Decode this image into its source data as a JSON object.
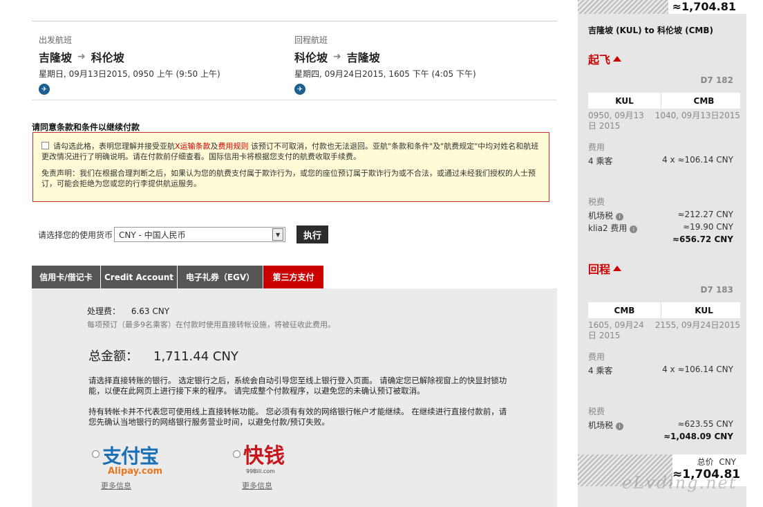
{
  "outbound": {
    "label": "出发航班",
    "from": "吉隆坡",
    "to": "科伦坡",
    "date": "星期日, 09月13日2015, 0950 上午 (9:50 上午)"
  },
  "return": {
    "label": "回程航班",
    "from": "科伦坡",
    "to": "吉隆坡",
    "date": "星期四, 09月24日2015, 1605 下午 (4:05 下午)"
  },
  "terms": {
    "title": "请同意条款和条件以继续付款",
    "agree_pre": "请勾选此格，表明您理解并接受亚航",
    "link1": "X运输条款",
    "and": "及",
    "link2": "费用规则",
    "agree_post": " 该预订不可取消，付款也无法退回。亚航\"条款和条件\"及\"航费规定\"中均对姓名和航班更改情况进行了明确说明。请在付款前仔细查看。国际信用卡将根据您支付的航费收取手续费。",
    "disclaimer": "免责声明：我们在根据合理判断之后，如果认为您的航费支付属于欺诈行为，或您的座位预订属于欺诈行为或不合法，或通过未经我们授权的人士预订，可能会拒绝为您或您的行李提供航运服务。"
  },
  "currency": {
    "label": "请选择您的使用货币",
    "selected": "CNY - 中国人民币",
    "go": "执行"
  },
  "tabs": [
    "信用卡/借记卡",
    "Credit Account",
    "电子礼券（EGV）",
    "第三方支付"
  ],
  "payment": {
    "fee_label": "处理费：",
    "fee_value": "6.63 CNY",
    "fee_note": "每项预订（最多9名乘客）在付款时使用直接转帐设施，将被征收此费用。",
    "total_label": "总金额：",
    "total_value": "1,711.44 CNY",
    "para1": "请选择直接转账的银行。 选定银行之后，系统会自动引导您至线上银行登入页面。 请确定您已解除视窗上的快显封锁功能，以便在此网页上进行接下来的程序。 请完成整个付款程序，以避免您的未确认预订被取消。",
    "para2": "持有转帐卡并不代表您可使用线上直接转帐功能。 您必须有有效的网络银行帐户才能继续。 在继续进行直接付款前，请您先确认当地银行的网络银行服务营业时间，以避免付款/预订失败。",
    "alipay": {
      "cn": "支付宝",
      "en": "Alipay.com",
      "more": "更多信息"
    },
    "kuaiqian": {
      "cn": "快钱",
      "en": "99Bill.com",
      "more": "更多信息"
    }
  },
  "sidebar": {
    "top_price": "≈1,704.81",
    "route": "吉隆坡 (KUL) to 科伦坡 (CMB)",
    "depart": {
      "head": "起飞",
      "flight_no": "D7 182",
      "from": "KUL",
      "to": "CMB",
      "dep_time": "0950, 09月13日 2015",
      "arr_time": "1040, 09月13日2015",
      "fare_label": "费用",
      "pax": "4 乘客",
      "pax_fare": "4 x ≈106.14 CNY",
      "tax_label": "税费",
      "tax1": "机场税",
      "tax1_val": "≈212.27 CNY",
      "tax2": "klia2 费用",
      "tax2_val": "≈19.90 CNY",
      "subtotal": "≈656.72 CNY"
    },
    "return": {
      "head": "回程",
      "flight_no": "D7 183",
      "from": "CMB",
      "to": "KUL",
      "dep_time": "1605, 09月24日 2015",
      "arr_time": "2155, 09月24日2015",
      "fare_label": "费用",
      "pax": "4 乘客",
      "pax_fare": "4 x ≈106.14 CNY",
      "tax_label": "税费",
      "tax1": "机场税",
      "tax1_val": "≈623.55 CNY",
      "subtotal": "≈1,048.09 CNY"
    },
    "total_label": "总价",
    "total_cur": "CNY",
    "total_value": "≈1,704.81"
  },
  "watermark": "eLvding.net"
}
